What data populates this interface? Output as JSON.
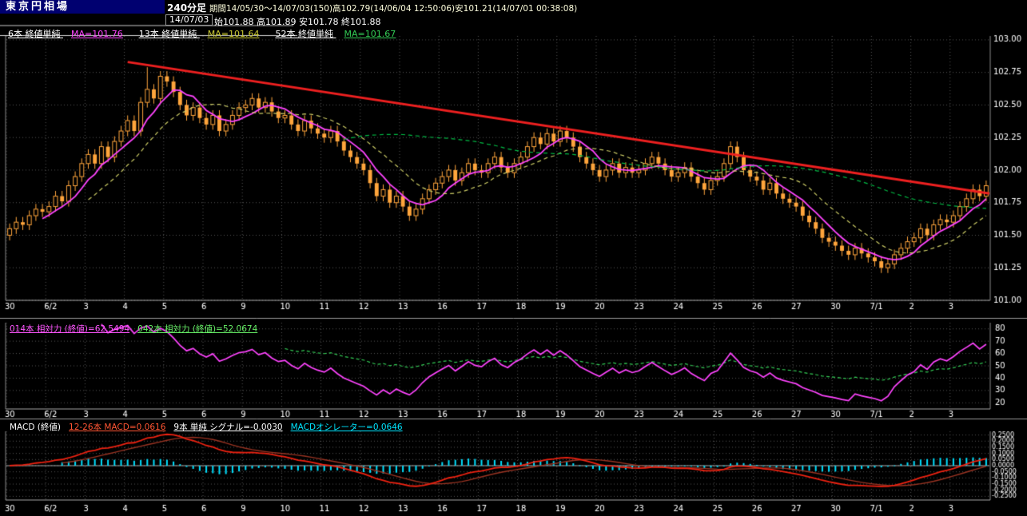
{
  "header": {
    "app_title": "東京円相場",
    "timeframe": "240分足",
    "period_info": "期間14/05/30～14/07/03(150)高102.79(14/06/04 12:50:06)安101.21(14/07/01 00:38:08)",
    "date": "14/07/03",
    "quote": "始101.88 高101.89 安101.78 終101.88"
  },
  "ma_legend": [
    {
      "label": "6本 終値単純",
      "value": "MA=101.76",
      "color": "#ff44ff"
    },
    {
      "label": "13本 終値単純",
      "value": "MA=101.64",
      "color": "#cccc33"
    },
    {
      "label": "52本 終値単純",
      "value": "MA=101.67",
      "color": "#33cc55"
    }
  ],
  "rsi_legend": [
    {
      "text": "014本 相対力 (終値)=62.5494",
      "color": "#ff55ff"
    },
    {
      "text": "042本 相対力 (終値)=52.0674",
      "color": "#66ee66"
    }
  ],
  "macd_legend": {
    "title": "MACD (終値)",
    "items": [
      {
        "text": "12-26本 MACD=0.0616",
        "color": "#ff5533"
      },
      {
        "text": "9本 単純 シグナル=-0.0030",
        "color": "#ffffff"
      },
      {
        "text": "MACDオシレーター=0.0646",
        "color": "#00e5ff"
      }
    ]
  },
  "chart_data": [
    {
      "type": "candlestick",
      "title": "東京円相場 240分足",
      "period_high": 102.79,
      "period_low": 101.21,
      "bars_per_day": 6,
      "x_labels": [
        "30",
        "6/2",
        "3",
        "4",
        "5",
        "6",
        "9",
        "10",
        "11",
        "12",
        "13",
        "16",
        "17",
        "18",
        "19",
        "20",
        "23",
        "24",
        "25",
        "26",
        "27",
        "30",
        "7/1",
        "2",
        "3"
      ],
      "y_ticks": [
        "103.00",
        "102.75",
        "102.50",
        "102.25",
        "102.00",
        "101.75",
        "101.50",
        "101.25",
        "101.00"
      ],
      "ylim": [
        101.0,
        103.03
      ],
      "first_open": 101.5,
      "default_wick": 0.04,
      "closes": [
        101.55,
        101.6,
        101.58,
        101.65,
        101.7,
        101.68,
        101.72,
        101.8,
        101.76,
        101.88,
        101.95,
        102.05,
        102.12,
        102.05,
        102.18,
        102.1,
        102.22,
        102.3,
        102.38,
        102.3,
        102.52,
        102.62,
        102.55,
        102.72,
        102.68,
        102.6,
        102.5,
        102.42,
        102.48,
        102.4,
        102.35,
        102.42,
        102.3,
        102.35,
        102.42,
        102.48,
        102.5,
        102.55,
        102.48,
        102.52,
        102.45,
        102.4,
        102.42,
        102.35,
        102.3,
        102.38,
        102.32,
        102.28,
        102.25,
        102.3,
        102.22,
        102.15,
        102.1,
        102.05,
        102.0,
        101.9,
        101.8,
        101.85,
        101.75,
        101.8,
        101.72,
        101.65,
        101.7,
        101.78,
        101.85,
        101.9,
        101.95,
        102.0,
        101.92,
        101.98,
        102.05,
        102.0,
        101.98,
        102.05,
        102.1,
        102.02,
        101.98,
        102.05,
        102.1,
        102.18,
        102.25,
        102.2,
        102.28,
        102.22,
        102.3,
        102.25,
        102.18,
        102.1,
        102.05,
        102.0,
        101.95,
        102.0,
        102.05,
        101.98,
        102.02,
        101.98,
        102.0,
        102.05,
        102.1,
        102.05,
        102.0,
        101.95,
        101.98,
        102.02,
        101.95,
        101.9,
        101.85,
        101.92,
        101.95,
        102.05,
        102.18,
        102.1,
        102.0,
        101.95,
        101.92,
        101.85,
        101.9,
        101.82,
        101.78,
        101.75,
        101.72,
        101.65,
        101.6,
        101.55,
        101.48,
        101.45,
        101.42,
        101.38,
        101.35,
        101.4,
        101.36,
        101.33,
        101.3,
        101.25,
        101.28,
        101.35,
        101.4,
        101.45,
        101.48,
        101.55,
        101.5,
        101.58,
        101.62,
        101.6,
        101.65,
        101.72,
        101.78,
        101.85,
        101.8,
        101.88
      ],
      "overrides": {
        "21": {
          "high": 102.79
        },
        "133": {
          "low": 101.21
        }
      },
      "moving_averages": [
        {
          "period": 6,
          "color": "#ff44ff",
          "style": "solid"
        },
        {
          "period": 13,
          "color": "#cccc66",
          "style": "dashed"
        },
        {
          "period": 52,
          "color": "#00bb44",
          "style": "dashed"
        }
      ],
      "trendline": {
        "from_bar": 18,
        "from_price": 102.83,
        "to_bar": 149.5,
        "to_price": 101.82,
        "color": "#ee2020"
      },
      "colors": {
        "grid": "#565656",
        "candle": "#ffa53c",
        "frame": "#888888",
        "axis_text": "#ffffff"
      }
    },
    {
      "type": "line",
      "indicator": "RSI 相対力",
      "periods": [
        14,
        42
      ],
      "latest_values": [
        62.5494,
        52.0674
      ],
      "y_ticks": [
        "80",
        "70",
        "60",
        "50",
        "40",
        "30",
        "20"
      ],
      "ylim": [
        15,
        85
      ],
      "colors": {
        "p14": "#ff44ff",
        "p42": "#33cc55"
      }
    },
    {
      "type": "line+histogram",
      "indicator": "MACD",
      "fast": 12,
      "slow": 26,
      "signal": 9,
      "latest_macd": 0.0616,
      "latest_signal": -0.003,
      "latest_osc": 0.0646,
      "y_ticks": [
        "0.2500",
        "0.2000",
        "0.1500",
        "0.1000",
        "0.0500",
        "0.0000",
        "-0.0500",
        "-0.1000",
        "-0.1500",
        "-0.2000",
        "-0.2500"
      ],
      "ylim": [
        -0.28,
        0.28
      ],
      "colors": {
        "macd": "#ee2211",
        "signal": "#993322",
        "histogram": "#00e0ff"
      }
    }
  ]
}
